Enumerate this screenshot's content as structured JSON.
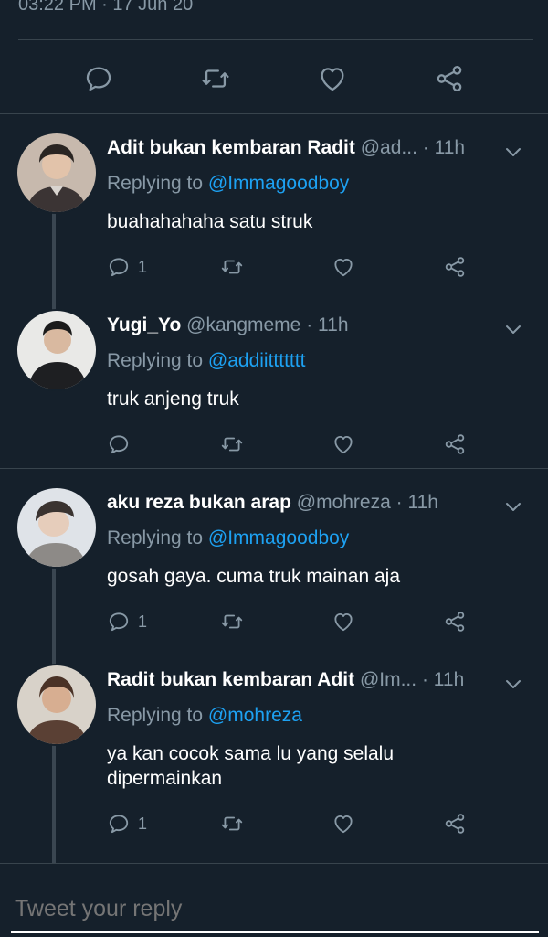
{
  "tweet_meta": "03:22 PM · 17 Jun 20",
  "main_actions": [
    "reply-icon",
    "retweet-icon",
    "like-icon",
    "share-icon"
  ],
  "replies": [
    {
      "name": "Adit bukan kembaran Radit",
      "handle": "@ad...",
      "time": "11h",
      "replying_label": "Replying to",
      "replying_to": "@Immagoodboy",
      "text": "buahahahaha satu struk",
      "reply_count": "1",
      "avatar_colors": [
        "#c7b9ad",
        "#3b3434"
      ]
    },
    {
      "name": "Yugi_Yo",
      "handle": "@kangmeme",
      "time": "11h",
      "replying_label": "Replying to",
      "replying_to": "@addiittttttt",
      "text": "truk anjeng truk",
      "reply_count": "",
      "avatar_colors": [
        "#e9e9e7",
        "#1e1f22"
      ]
    },
    {
      "name": "aku reza bukan arap",
      "handle": "@mohreza",
      "time": "11h",
      "replying_label": "Replying to",
      "replying_to": "@Immagoodboy",
      "text": "gosah gaya. cuma truk mainan aja",
      "reply_count": "1",
      "avatar_colors": [
        "#dfe3e8",
        "#8d8a87"
      ]
    },
    {
      "name": "Radit bukan kembaran Adit",
      "handle": "@Im...",
      "time": "11h",
      "replying_label": "Replying to",
      "replying_to": "@mohreza",
      "text": "ya kan cocok sama lu yang selalu dipermainkan",
      "reply_count": "1",
      "avatar_colors": [
        "#d8d2c9",
        "#5a4034"
      ]
    }
  ],
  "compose": {
    "placeholder": "Tweet your reply"
  },
  "colors": {
    "background": "#15202b",
    "accent": "#1da1f2",
    "muted": "#8899a6"
  }
}
